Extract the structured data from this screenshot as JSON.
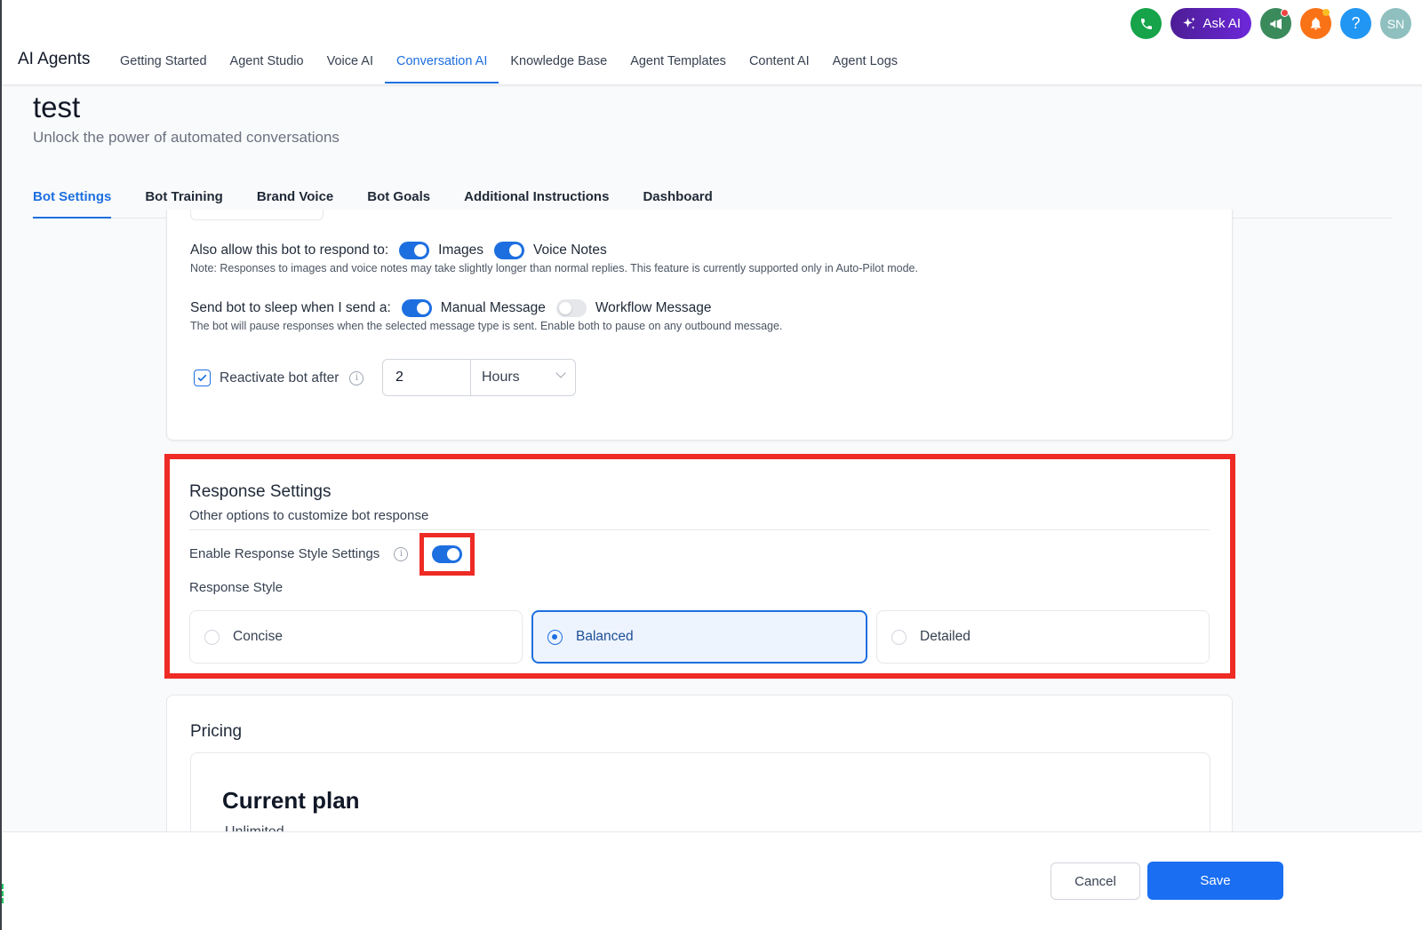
{
  "app": {
    "title": "AI Agents",
    "nav": [
      "Getting Started",
      "Agent Studio",
      "Voice AI",
      "Conversation AI",
      "Knowledge Base",
      "Agent Templates",
      "Content AI",
      "Agent Logs"
    ],
    "active_nav": "Conversation AI",
    "ask_ai_label": "Ask AI",
    "help_label": "?",
    "avatar_initials": "SN",
    "colors": {
      "accent": "#1d6fe0",
      "phone": "#16a34a",
      "ask_ai": "#5b21b6",
      "announce": "#3a8a5c",
      "bell": "#f97316",
      "help": "#2196f3",
      "avatar": "#8fbfbf",
      "highlight": "#ee2b24"
    }
  },
  "page": {
    "title": "test",
    "subtitle": "Unlock the power of automated conversations",
    "tabs": [
      "Bot Settings",
      "Bot Training",
      "Brand Voice",
      "Bot Goals",
      "Additional Instructions",
      "Dashboard"
    ],
    "active_tab": "Bot Settings"
  },
  "bot_settings": {
    "respond_label": "Also allow this bot to respond to:",
    "images_label": "Images",
    "images_enabled": true,
    "voice_label": "Voice Notes",
    "voice_enabled": true,
    "respond_note": "Note: Responses to images and voice notes may take slightly longer than normal replies. This feature is currently supported only in Auto-Pilot mode.",
    "sleep_label": "Send bot to sleep when I send a:",
    "manual_label": "Manual Message",
    "manual_enabled": true,
    "workflow_label": "Workflow Message",
    "workflow_enabled": false,
    "sleep_note": "The bot will pause responses when the selected message type is sent. Enable both to pause on any outbound message.",
    "reactivate_label": "Reactivate bot after",
    "reactivate_checked": true,
    "reactivate_value": "2",
    "reactivate_unit": "Hours"
  },
  "response_settings": {
    "title": "Response Settings",
    "subtitle": "Other options to customize bot response",
    "enable_label": "Enable Response Style Settings",
    "enable_on": true,
    "style_label": "Response Style",
    "options": [
      "Concise",
      "Balanced",
      "Detailed"
    ],
    "selected": "Balanced"
  },
  "pricing": {
    "title": "Pricing",
    "plan_title": "Current plan",
    "plan_name": "Unlimited"
  },
  "footer": {
    "cancel_label": "Cancel",
    "save_label": "Save"
  }
}
